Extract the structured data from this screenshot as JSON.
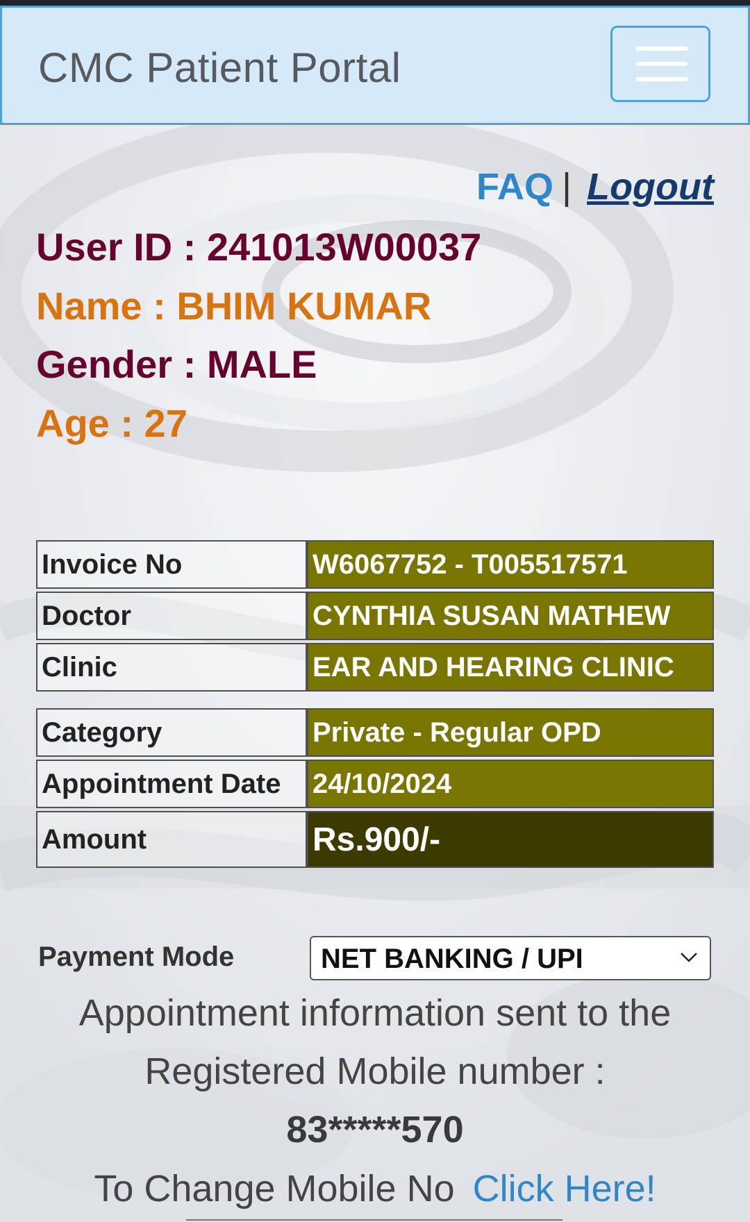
{
  "header": {
    "brand": "CMC Patient Portal",
    "menu_icon": "hamburger-menu-icon"
  },
  "top_links": {
    "faq": "FAQ",
    "separator": "|",
    "logout": "Logout"
  },
  "patient": {
    "user_id": "User ID : 241013W00037",
    "name": "Name : BHIM KUMAR",
    "gender": "Gender : MALE",
    "age": "Age : 27"
  },
  "details_table_1": [
    {
      "label": "Invoice No",
      "value": "W6067752 - T005517571"
    },
    {
      "label": "Doctor",
      "value": "CYNTHIA SUSAN MATHEW"
    },
    {
      "label": "Clinic",
      "value": "EAR AND HEARING CLINIC"
    }
  ],
  "details_table_2": [
    {
      "label": "Category",
      "value": "Private - Regular OPD"
    },
    {
      "label": "Appointment Date",
      "value": "24/10/2024"
    },
    {
      "label": "Amount",
      "value": "Rs.900/-"
    }
  ],
  "payment": {
    "label": "Payment Mode",
    "selected": "NET BANKING / UPI"
  },
  "message": {
    "line1": "Appointment information sent to the",
    "line2": "Registered Mobile number :",
    "mobile": "83*****570",
    "change_text": "To Change Mobile No",
    "click_here": "Click Here!"
  },
  "colors": {
    "navbar_bg": "#d6e9f8",
    "navbar_border": "#4aa3df",
    "maroon": "#65032e",
    "orange": "#d9730f",
    "table_value_bg": "#787600",
    "amount_bg": "#3d3a00",
    "link_blue": "#2f86c8"
  }
}
